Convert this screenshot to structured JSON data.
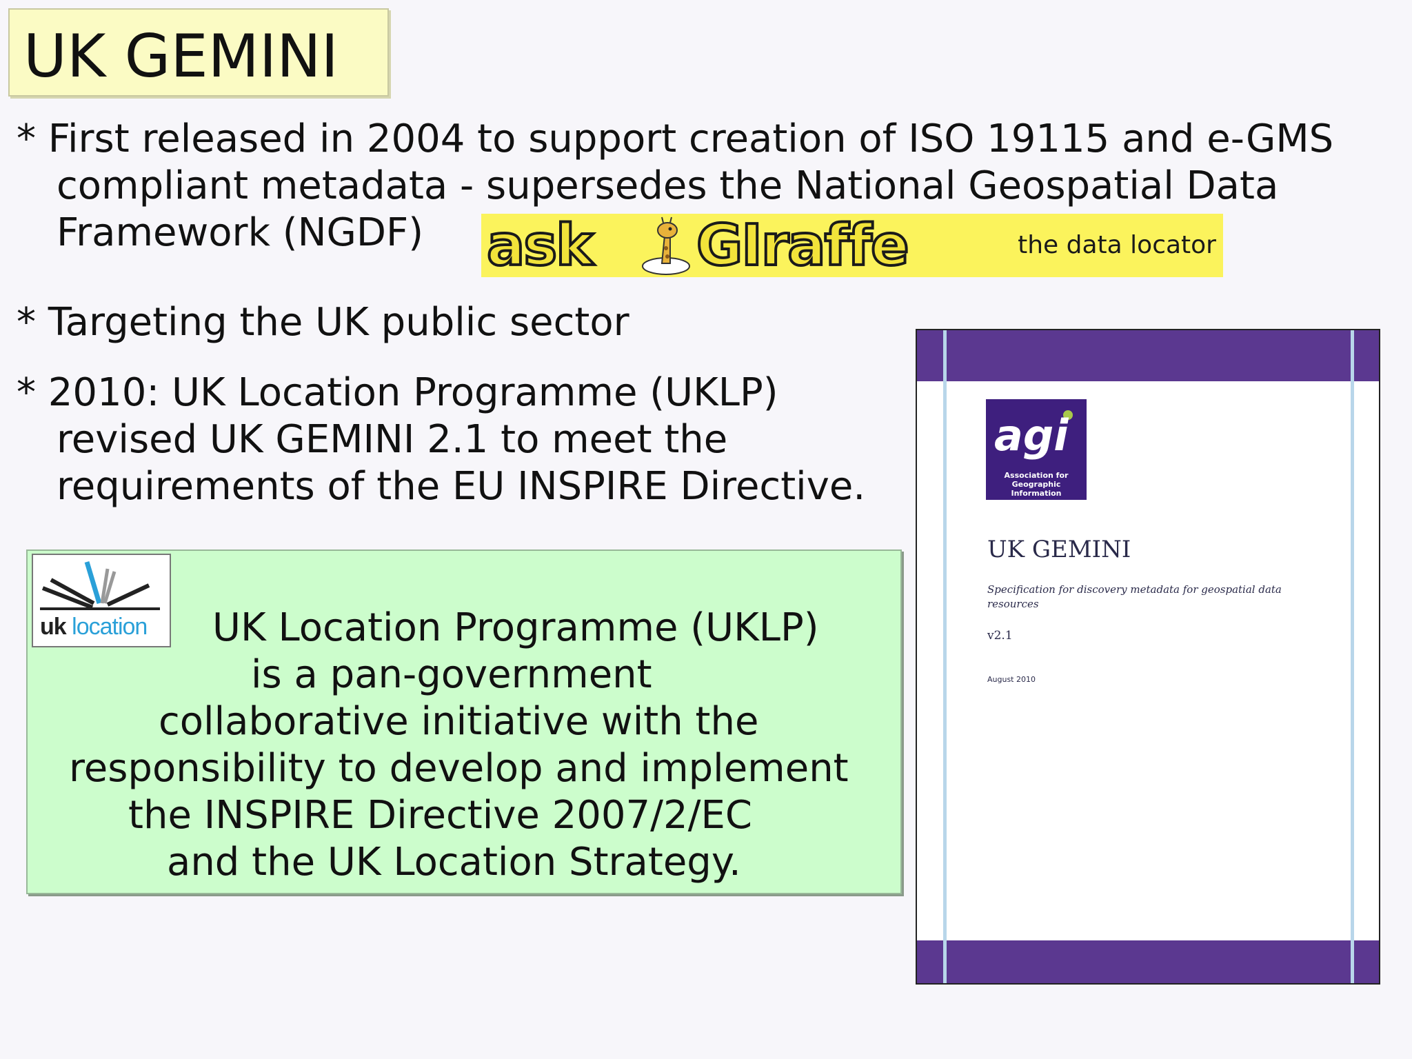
{
  "slide": {
    "title": "UK GEMINI",
    "bullets": [
      {
        "lines": [
          "* First released in 2004 to support creation of ISO 19115 and e-GMS",
          "compliant metadata - supersedes the National Geospatial Data",
          "Framework (NGDF)"
        ]
      },
      {
        "lines": [
          "* Targeting the UK public sector"
        ]
      },
      {
        "lines": [
          "* 2010: UK Location Programme (UKLP)",
          "revised UK GEMINI 2.1 to meet the",
          "requirements of the EU INSPIRE Directive."
        ]
      }
    ],
    "ask_giraffe_logo": {
      "brand": "askGIraffe",
      "tagline": "the data locator",
      "background_color": "#fbf35c"
    },
    "uklp_box": {
      "logo": {
        "uk": "uk",
        "location": "location",
        "accent_color": "#2aa0d8"
      },
      "lines": [
        "UK Location Programme (UKLP)",
        "is a pan-government",
        "collaborative initiative with the",
        "responsibility to develop and implement",
        "the INSPIRE Directive 2007/2/EC",
        "and the UK Location Strategy."
      ],
      "background_color": "#ccfdcc"
    },
    "document_cover": {
      "logo_word": "agi",
      "logo_subtitle_1": "Association for",
      "logo_subtitle_2": "Geographic Information",
      "title": "UK GEMINI",
      "subtitle": "Specification for discovery metadata for geospatial data resources",
      "version": "v2.1",
      "date": "August 2010",
      "band_color": "#5b3890"
    }
  }
}
